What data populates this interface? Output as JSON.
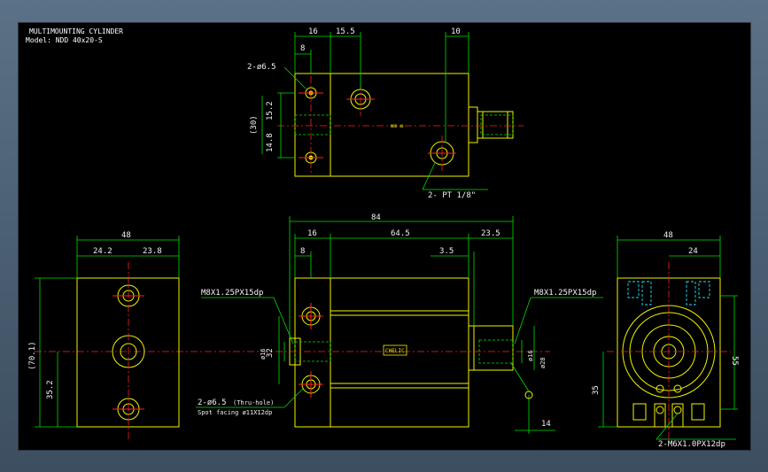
{
  "title": "MULTIMOUNTING CYLINDER",
  "model": "Model: NDD 40x20-S",
  "top_view": {
    "dims": [
      "16",
      "15.5",
      "8",
      "10",
      "2-ø6.5",
      "15.2",
      "14.8",
      "(30)",
      "2- PT 1/8\""
    ],
    "body_label": "NDD 40"
  },
  "front_view": {
    "dims": [
      "84",
      "16",
      "64.5",
      "23.5",
      "8",
      "3.5",
      "32",
      "ø16",
      "ø16",
      "ø28",
      "14"
    ],
    "thread_left": "M8X1.25PX15dp",
    "thread_right": "M8X1.25PX15dp",
    "hole_note": "2-ø6.5",
    "hole_note_2": "(Thru-hole)",
    "spot_facing": "Spot facing  ø11X12dp",
    "body_label": "CHELIC"
  },
  "left_view": {
    "dims": [
      "48",
      "24.2",
      "23.8",
      "(70.1)",
      "35.2"
    ]
  },
  "right_view": {
    "dims": [
      "48",
      "24",
      "55",
      "35"
    ],
    "thread_note": "2-M6X1.0PX12dp"
  }
}
